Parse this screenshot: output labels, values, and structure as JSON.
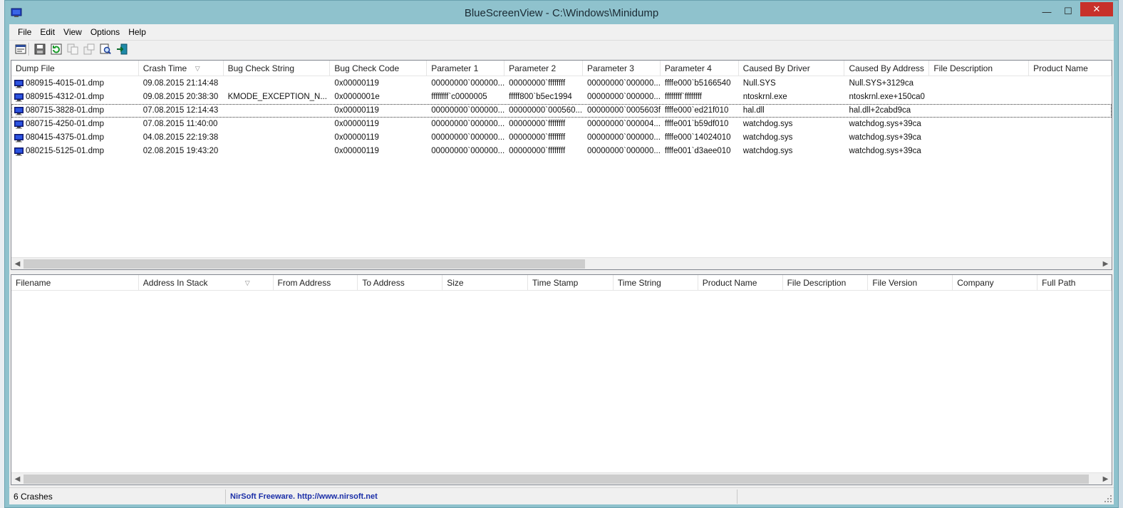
{
  "window": {
    "title": "BlueScreenView  -  C:\\Windows\\Minidump",
    "minimize": "—",
    "maximize": "☐",
    "close": "✕"
  },
  "menu": [
    "File",
    "Edit",
    "View",
    "Options",
    "Help"
  ],
  "toolbar": [
    "properties-icon",
    "save-icon",
    "refresh-icon",
    "copy-icon",
    "export-icon",
    "find-icon",
    "exit-icon"
  ],
  "crashes": {
    "columns": [
      "Dump File",
      "Crash Time",
      "Bug Check String",
      "Bug Check Code",
      "Parameter 1",
      "Parameter 2",
      "Parameter 3",
      "Parameter 4",
      "Caused By Driver",
      "Caused By Address",
      "File Description",
      "Product Name"
    ],
    "sort_column": "Crash Time",
    "rows": [
      [
        "080915-4015-01.dmp",
        "09.08.2015 21:14:48",
        "",
        "0x00000119",
        "00000000`000000...",
        "00000000`ffffffff",
        "00000000`000000...",
        "ffffe000`b5166540",
        "Null.SYS",
        "Null.SYS+3129ca",
        "",
        ""
      ],
      [
        "080915-4312-01.dmp",
        "09.08.2015 20:38:30",
        "KMODE_EXCEPTION_N...",
        "0x0000001e",
        "ffffffff`c0000005",
        "fffff800`b5ec1994",
        "00000000`000000...",
        "ffffffff`ffffffff",
        "ntoskrnl.exe",
        "ntoskrnl.exe+150ca0",
        "",
        ""
      ],
      [
        "080715-3828-01.dmp",
        "07.08.2015 12:14:43",
        "",
        "0x00000119",
        "00000000`000000...",
        "00000000`000560...",
        "00000000`0005603f",
        "ffffe000`ed21f010",
        "hal.dll",
        "hal.dll+2cabd9ca",
        "",
        ""
      ],
      [
        "080715-4250-01.dmp",
        "07.08.2015 11:40:00",
        "",
        "0x00000119",
        "00000000`000000...",
        "00000000`ffffffff",
        "00000000`000004...",
        "ffffe001`b59df010",
        "watchdog.sys",
        "watchdog.sys+39ca",
        "",
        ""
      ],
      [
        "080415-4375-01.dmp",
        "04.08.2015 22:19:38",
        "",
        "0x00000119",
        "00000000`000000...",
        "00000000`ffffffff",
        "00000000`000000...",
        "ffffe000`14024010",
        "watchdog.sys",
        "watchdog.sys+39ca",
        "",
        ""
      ],
      [
        "080215-5125-01.dmp",
        "02.08.2015 19:43:20",
        "",
        "0x00000119",
        "00000000`000000...",
        "00000000`ffffffff",
        "00000000`000000...",
        "ffffe001`d3aee010",
        "watchdog.sys",
        "watchdog.sys+39ca",
        "",
        ""
      ]
    ],
    "selected_row": 2
  },
  "modules": {
    "columns": [
      "Filename",
      "Address In Stack",
      "From Address",
      "To Address",
      "Size",
      "Time Stamp",
      "Time String",
      "Product Name",
      "File Description",
      "File Version",
      "Company",
      "Full Path"
    ],
    "sort_column": "Address In Stack",
    "rows": []
  },
  "statusbar": {
    "count": "6 Crashes",
    "credit": "NirSoft Freeware.  http://www.nirsoft.net"
  },
  "colors": {
    "frame": "#8fc2cd",
    "close_button": "#c7312a",
    "link": "#1b2fa8"
  }
}
